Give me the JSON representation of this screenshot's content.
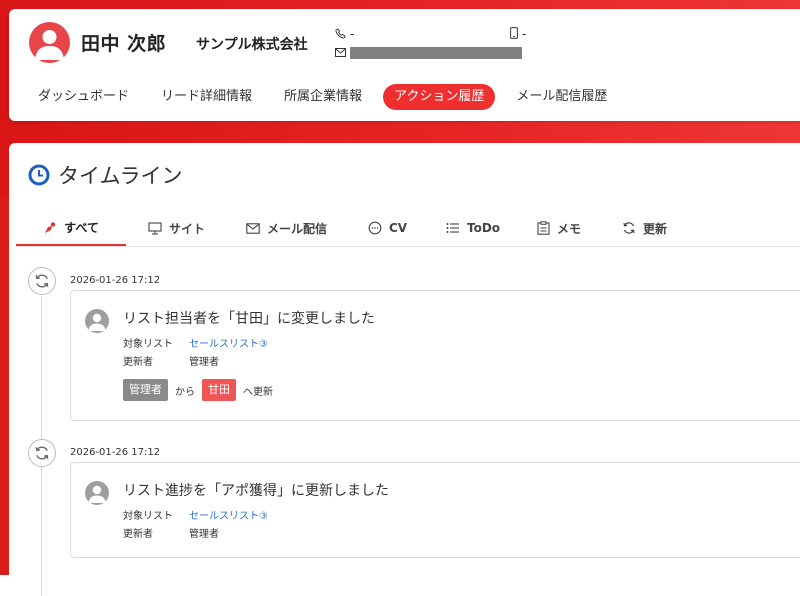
{
  "person": {
    "name": "田中 次郎",
    "company": "サンプル株式会社",
    "phone": "-",
    "mobile": "-"
  },
  "nav": {
    "tabs": [
      "ダッシュボード",
      "リード詳細情報",
      "所属企業情報",
      "アクション履歴",
      "メール配信履歴"
    ],
    "active": "アクション履歴"
  },
  "timeline": {
    "title": "タイムライン",
    "filters": [
      {
        "label": "すべて",
        "icon": "all-icon",
        "active": true
      },
      {
        "label": "サイト",
        "icon": "monitor-icon"
      },
      {
        "label": "メール配信",
        "icon": "mail-icon"
      },
      {
        "label": "CV",
        "icon": "chat-icon"
      },
      {
        "label": "ToDo",
        "icon": "list-icon"
      },
      {
        "label": "メモ",
        "icon": "clipboard-icon"
      },
      {
        "label": "更新",
        "icon": "sync-icon"
      }
    ],
    "entries": [
      {
        "timestamp": "2026-01-26 17:12",
        "title": "リスト担当者を「甘田」に変更しました",
        "target_label": "対象リスト",
        "target_value": "セールスリスト③",
        "updater_label": "更新者",
        "updater_value": "管理者",
        "change_from": "管理者",
        "from_word": "から",
        "change_to": "甘田",
        "to_word": "へ更新"
      },
      {
        "timestamp": "2026-01-26 17:12",
        "title": "リスト進捗を「アポ獲得」に更新しました",
        "target_label": "対象リスト",
        "target_value": "セールスリスト③",
        "updater_label": "更新者",
        "updater_value": "管理者"
      }
    ]
  },
  "colors": {
    "brand_red": "#e52424",
    "active_tab": "#ef2f2f",
    "link": "#2a6fd6",
    "pill_gray": "#8a8a8a",
    "pill_red": "#f05656"
  }
}
